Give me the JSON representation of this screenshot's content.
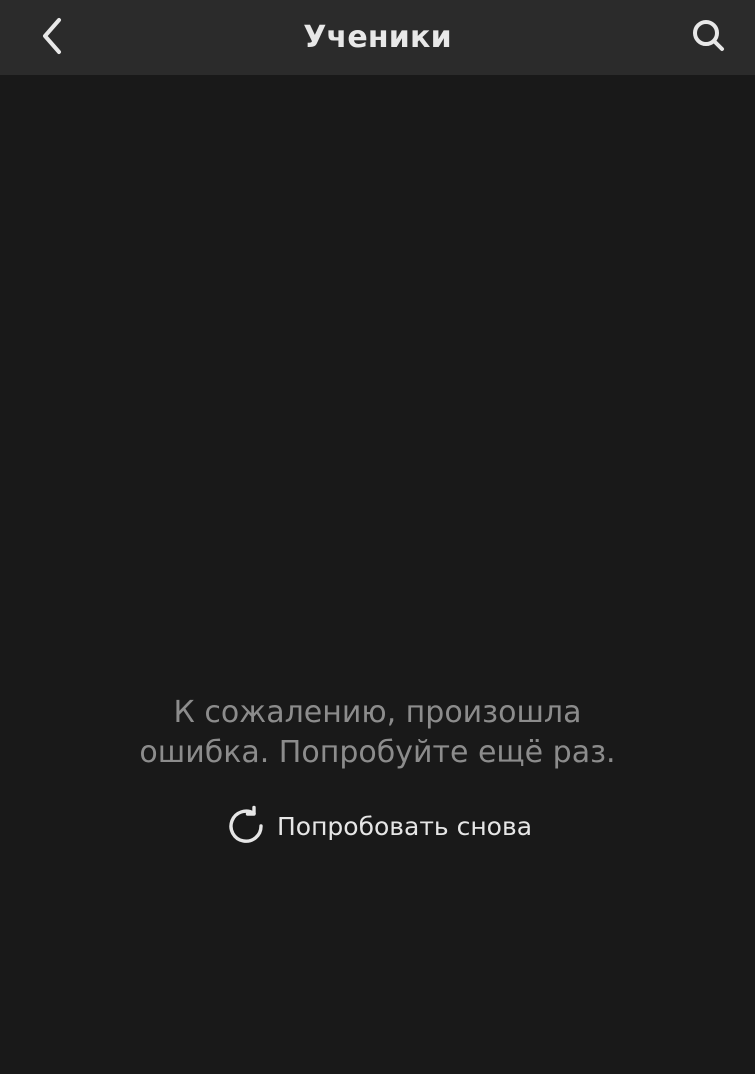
{
  "header": {
    "title": "Ученики",
    "back_icon": "chevron-left-icon",
    "search_icon": "search-icon"
  },
  "error": {
    "message_line1": "К сожалению, произошла",
    "message_line2": "ошибка. Попробуйте ещё раз.",
    "retry_label": "Попробовать снова",
    "retry_icon": "refresh-icon"
  },
  "colors": {
    "background": "#191919",
    "header_background": "#2b2b2b",
    "header_text": "#e8e8e8",
    "message_text": "#8c8c8c",
    "retry_text": "#e6e6e6"
  }
}
